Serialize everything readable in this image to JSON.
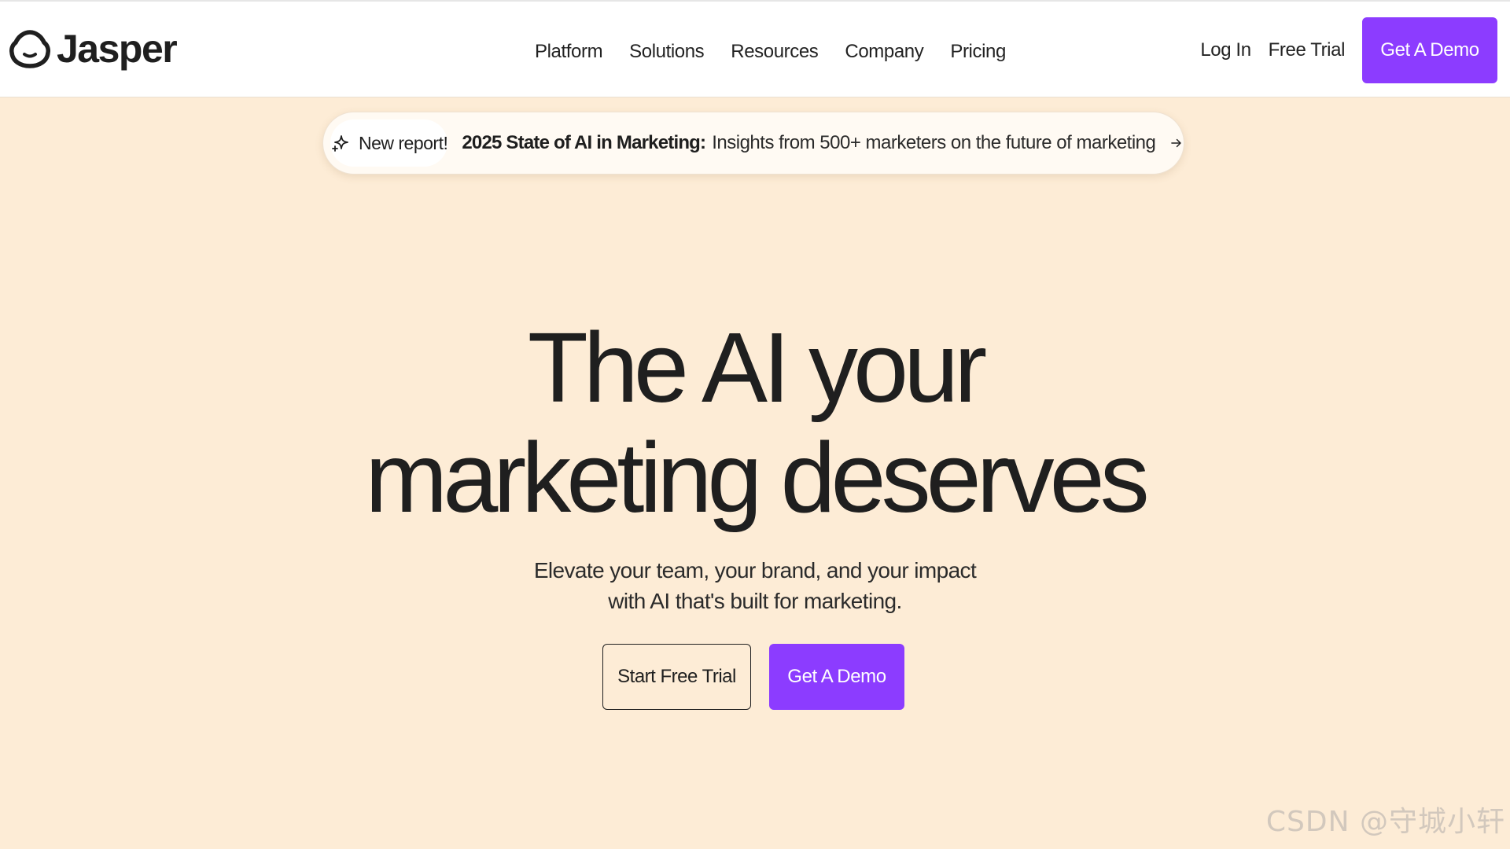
{
  "brand": {
    "name": "Jasper",
    "logo_icon": "jasper-face-icon",
    "accent_color": "#8c3cff",
    "background_color": "#fdecd6"
  },
  "nav": {
    "items": [
      {
        "label": "Platform"
      },
      {
        "label": "Solutions"
      },
      {
        "label": "Resources"
      },
      {
        "label": "Company"
      },
      {
        "label": "Pricing"
      }
    ]
  },
  "header": {
    "login_label": "Log In",
    "free_trial_label": "Free Trial",
    "demo_label": "Get A Demo"
  },
  "banner": {
    "badge_icon": "sparkle-icon",
    "badge_label": "New report!",
    "title": "2025 State of AI in Marketing:",
    "description": "Insights from 500+ marketers on the future of marketing",
    "arrow_icon": "arrow-right-icon"
  },
  "hero": {
    "title_line1": "The AI your",
    "title_line2": "marketing deserves",
    "subtitle_line1": "Elevate your team, your brand, and your impact",
    "subtitle_line2": "with AI that's built for marketing.",
    "start_trial_label": "Start Free Trial",
    "demo_label": "Get A Demo"
  },
  "watermark": {
    "text": "CSDN @守城小轩"
  }
}
